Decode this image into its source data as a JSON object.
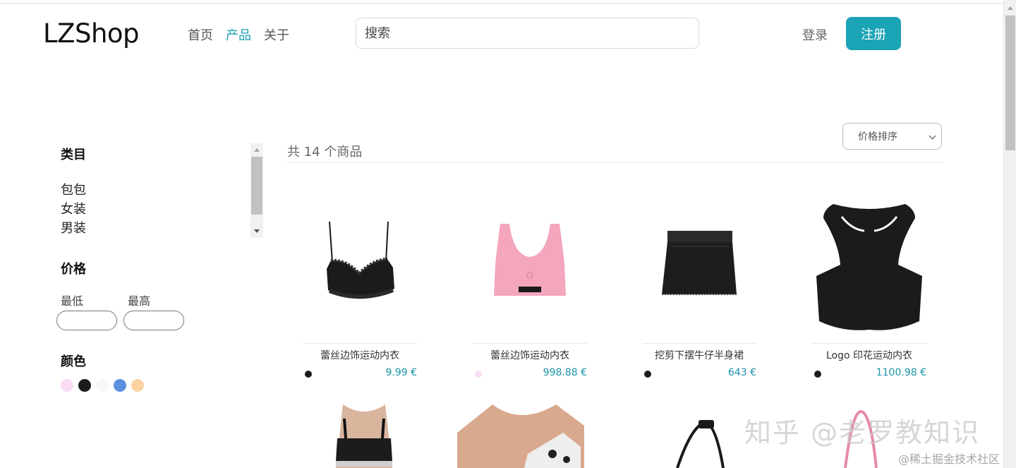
{
  "header": {
    "logo": "LZShop",
    "nav": [
      "首页",
      "产品",
      "关于"
    ],
    "active_nav_index": 1,
    "search_placeholder": "搜索",
    "login_label": "登录",
    "register_label": "注册",
    "accent_color": "#1ba3b6"
  },
  "sidebar": {
    "category_title": "类目",
    "categories": [
      "包包",
      "女装",
      "男装"
    ],
    "price_title": "价格",
    "price_min_label": "最低",
    "price_max_label": "最高",
    "price_min_value": "",
    "price_max_value": "",
    "color_title": "颜色",
    "colors": [
      "#f9dcf6",
      "#1c1c1c",
      "#f7f7f7",
      "#5b8fe0",
      "#fbd3a3"
    ]
  },
  "main": {
    "count_text": "共 14 个商品",
    "sort_label": "价格排序",
    "products": [
      {
        "name": "蕾丝边饰运动内衣",
        "price": "9.99 €",
        "color": "#1c1c1c",
        "image": "black-lace-bra"
      },
      {
        "name": "蕾丝边饰运动内衣",
        "price": "998.88 €",
        "color": "#f9dcf6",
        "image": "pink-sports-bra"
      },
      {
        "name": "挖剪下摆牛仔半身裙",
        "price": "643 €",
        "color": "#1c1c1c",
        "image": "black-denim-skirt"
      },
      {
        "name": "Logo 印花运动内衣",
        "price": "1100.98 €",
        "color": "#1c1c1c",
        "image": "black-racer-top"
      }
    ],
    "row2_images": [
      "model-black-bra",
      "model-print-top",
      "black-bag-strap",
      "pink-bag-strap"
    ]
  },
  "watermark": {
    "main": "知乎 @老罗教知识",
    "sub": "@稀土掘金技术社区"
  }
}
